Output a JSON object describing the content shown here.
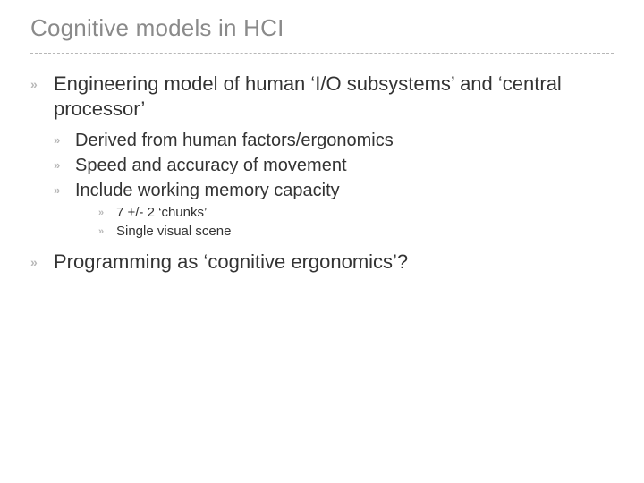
{
  "title": "Cognitive models in HCI",
  "bullet_glyph": "»",
  "items": [
    {
      "text": "Engineering model of human ‘I/O subsystems’ and ‘central processor’",
      "children": [
        {
          "text": "Derived from human factors/ergonomics"
        },
        {
          "text": "Speed and accuracy of movement"
        },
        {
          "text": "Include working memory capacity",
          "children": [
            {
              "text": "7 +/- 2 ‘chunks’"
            },
            {
              "text": "Single visual scene"
            }
          ]
        }
      ]
    },
    {
      "text": "Programming as ‘cognitive ergonomics’?"
    }
  ]
}
